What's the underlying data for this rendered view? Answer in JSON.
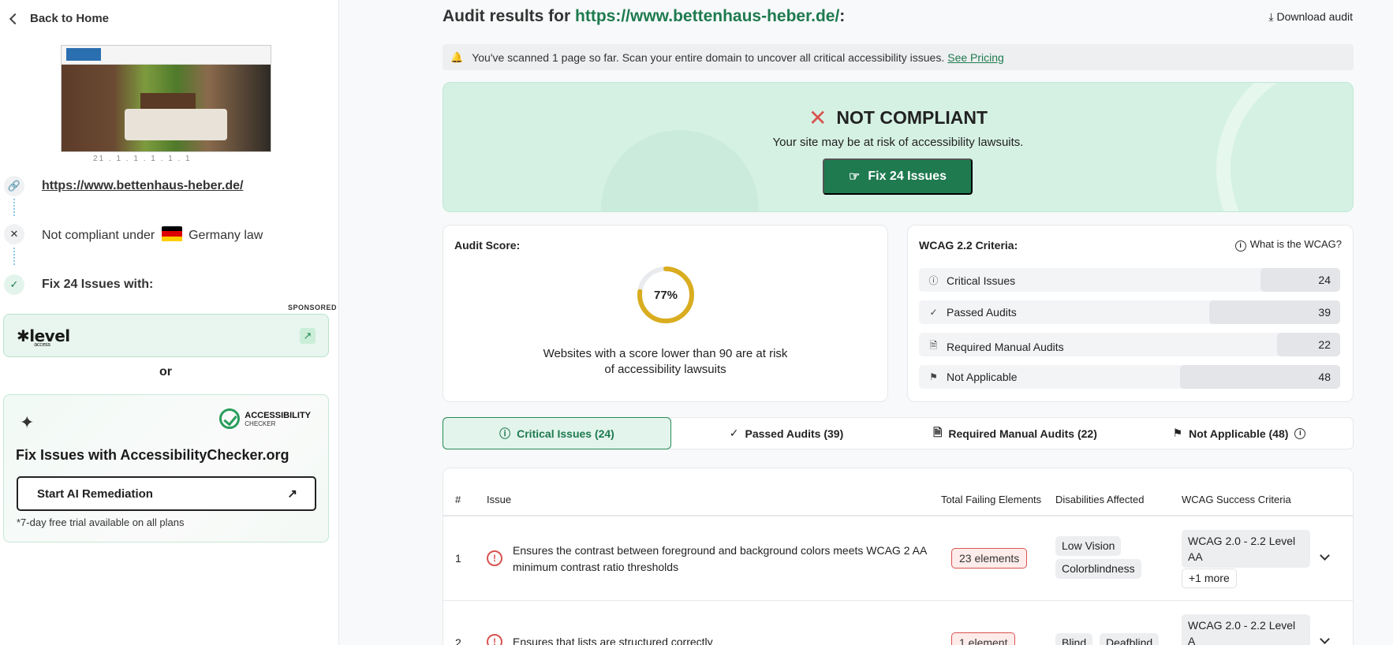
{
  "sidebar": {
    "back_label": "Back to Home",
    "thumb_caption": "21 . 1 . 1 . 1 . 1 . 1",
    "url": "https://www.bettenhaus-heber.de/",
    "compliance_prefix": "Not compliant under",
    "compliance_suffix": "Germany law",
    "fix_label": "Fix 24 Issues with:",
    "sponsored": "SPONSORED",
    "level_logo": "level",
    "level_sub": "access",
    "or": "or",
    "ac_logo_line1": "ACCESSIBILITY",
    "ac_logo_line2": "CHECKER",
    "ac_title": "Fix Issues with AccessibilityChecker.org",
    "ac_button": "Start AI Remediation",
    "ac_note": "*7-day free trial available on all plans"
  },
  "header": {
    "title_prefix": "Audit results for",
    "title_url": "https://www.bettenhaus-heber.de/",
    "title_suffix": ":",
    "download_label": "Download audit"
  },
  "notice": {
    "text": "You've scanned 1 page so far. Scan your entire domain to uncover all critical accessibility issues.",
    "link": "See Pricing"
  },
  "banner": {
    "status": "NOT COMPLIANT",
    "subtitle": "Your site may be at risk of accessibility lawsuits.",
    "button": "Fix 24 Issues"
  },
  "score": {
    "heading": "Audit Score:",
    "value": 77,
    "value_label": "77%",
    "desc_line1": "Websites with a score lower than 90 are at risk",
    "desc_line2": "of accessibility lawsuits"
  },
  "wcag": {
    "heading": "WCAG 2.2 Criteria:",
    "link": "What is the WCAG?",
    "rows": [
      {
        "label": "Critical Issues",
        "count": "24",
        "share": 0.19
      },
      {
        "label": "Passed Audits",
        "count": "39",
        "share": 0.31
      },
      {
        "label": "Required Manual Audits",
        "count": "22",
        "share": 0.15
      },
      {
        "label": "Not Applicable",
        "count": "48",
        "share": 0.38
      }
    ]
  },
  "tabs": [
    {
      "label": "Critical Issues (24)"
    },
    {
      "label": "Passed Audits (39)"
    },
    {
      "label": "Required Manual Audits (22)"
    },
    {
      "label": "Not Applicable (48)"
    }
  ],
  "table": {
    "headers": [
      "#",
      "Issue",
      "Total Failing Elements",
      "Disabilities Affected",
      "WCAG Success Criteria"
    ],
    "rows": [
      {
        "num": "1",
        "issue": "Ensures the contrast between foreground and background colors meets WCAG 2 AA minimum contrast ratio thresholds",
        "elements": "23 elements",
        "disabilities": [
          "Low Vision",
          "Colorblindness"
        ],
        "criteria": "WCAG 2.0 - 2.2 Level AA",
        "more": "+1 more"
      },
      {
        "num": "2",
        "issue": "Ensures that lists are structured correctly",
        "elements": "1 element",
        "disabilities": [
          "Blind",
          "Deafblind"
        ],
        "criteria": "WCAG 2.0 - 2.2 Level A"
      }
    ]
  }
}
